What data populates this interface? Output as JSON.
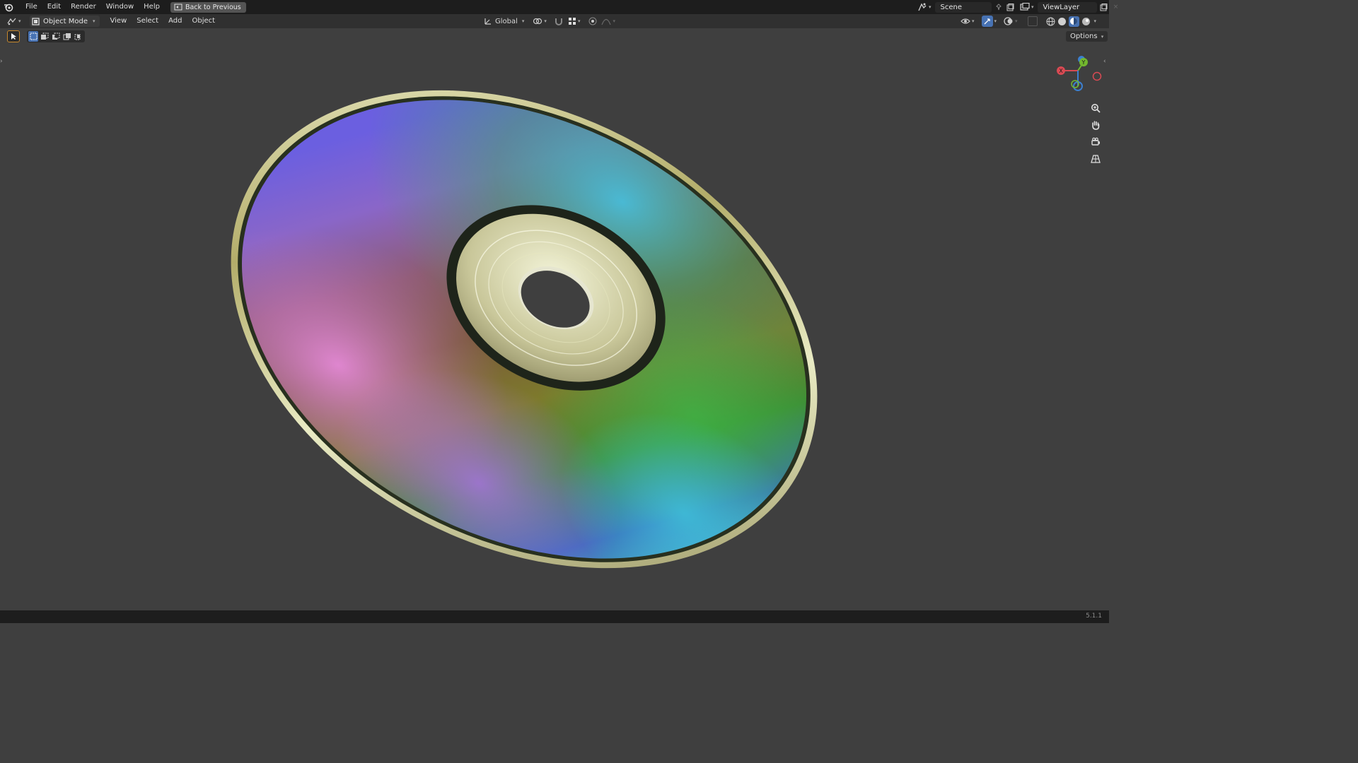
{
  "topbar": {
    "menus": [
      "File",
      "Edit",
      "Render",
      "Window",
      "Help"
    ],
    "back_button": "Back to Previous",
    "scene_name": "Scene",
    "view_layer": "ViewLayer"
  },
  "header": {
    "mode": "Object Mode",
    "menus": [
      "View",
      "Select",
      "Add",
      "Object"
    ],
    "transform_orientation": "Global"
  },
  "viewport": {
    "options_label": "Options",
    "gizmo_axes": {
      "x": "X",
      "y": "Y"
    },
    "object": "cd-disc"
  },
  "status": {
    "version": "5.1.1"
  },
  "colors": {
    "accent": "#4772b3",
    "x_axis": "#d94a53",
    "y_axis": "#72b82e",
    "z_axis": "#3c7fcf"
  },
  "icons": [
    "blender-logo-icon",
    "back-icon",
    "scene-icon",
    "pin-icon",
    "viewlayer-icon",
    "zoom-icon",
    "hand-pan-icon",
    "camera-icon",
    "perspective-grid-icon"
  ]
}
